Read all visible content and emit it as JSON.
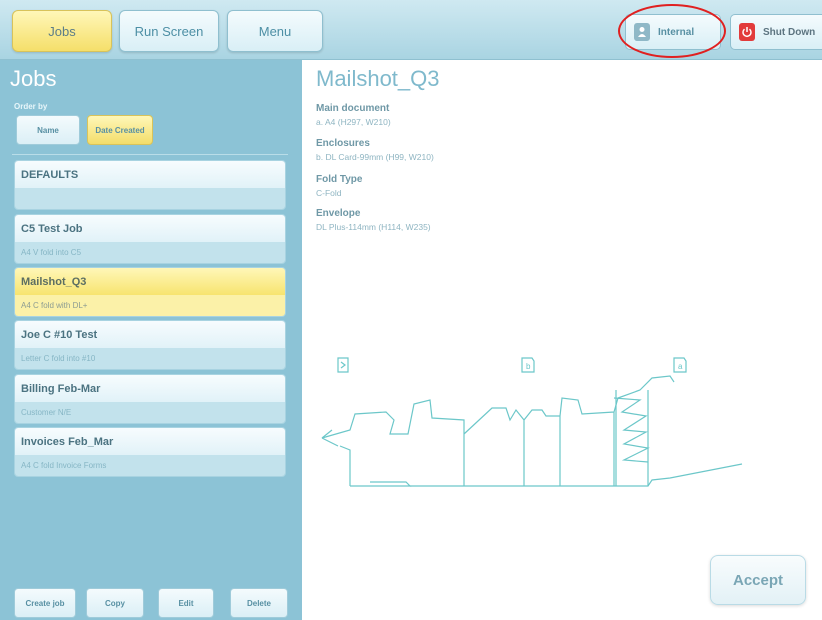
{
  "nav": {
    "tabs": [
      {
        "label": "Jobs",
        "active": true
      },
      {
        "label": "Run Screen",
        "active": false
      },
      {
        "label": "Menu",
        "active": false
      }
    ],
    "internal_label": "Internal",
    "shutdown_label": "Shut Down",
    "internal_icon": "user-icon",
    "shutdown_icon": "power-icon"
  },
  "sidebar": {
    "title": "Jobs",
    "order_by_label": "Order by",
    "sort_buttons": [
      {
        "label": "Name",
        "active": false
      },
      {
        "label": "Date Created",
        "active": true
      }
    ],
    "jobs": [
      {
        "name": "DEFAULTS",
        "desc": "",
        "selected": false
      },
      {
        "name": "C5 Test Job",
        "desc": "A4 V fold into C5",
        "selected": false
      },
      {
        "name": "Mailshot_Q3",
        "desc": "A4 C fold with DL+",
        "selected": true
      },
      {
        "name": "Joe C #10 Test",
        "desc": "Letter C fold into #10",
        "selected": false
      },
      {
        "name": "Billing Feb-Mar",
        "desc": "Customer N/E",
        "selected": false
      },
      {
        "name": "Invoices Feb_Mar",
        "desc": "A4 C fold Invoice Forms",
        "selected": false
      }
    ],
    "actions": [
      "Create job",
      "Copy",
      "Edit",
      "Delete"
    ]
  },
  "main": {
    "title": "Mailshot_Q3",
    "sections": [
      {
        "heading": "Main document",
        "value": "a. A4 (H297, W210)"
      },
      {
        "heading": "Enclosures",
        "value": "b. DL Card-99mm (H99, W210)"
      },
      {
        "heading": "Fold Type",
        "value": "C-Fold"
      },
      {
        "heading": "Envelope",
        "value": "DL Plus-114mm (H114, W235)"
      }
    ],
    "diagram_labels": {
      "b": "b",
      "a": "a"
    },
    "accept_label": "Accept"
  },
  "colors": {
    "accent_yellow": "#f5df6a",
    "panel_blue": "#8cc3d6",
    "highlight_red": "#e02020",
    "diagram_teal": "#6cc7c9"
  }
}
